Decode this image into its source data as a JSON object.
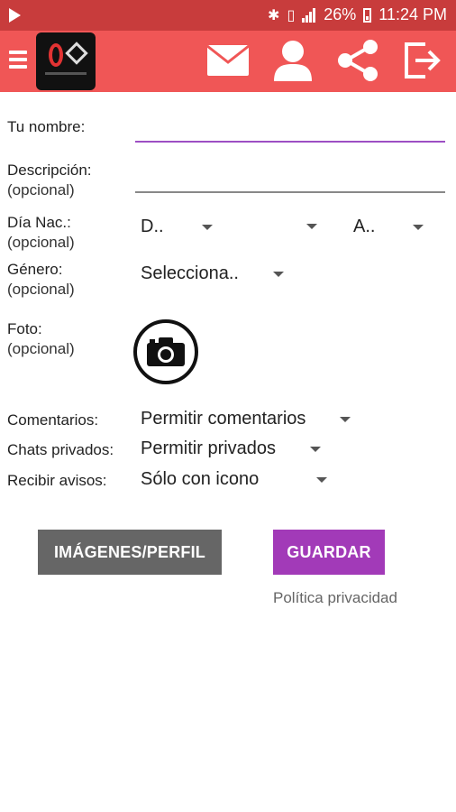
{
  "status_bar": {
    "battery": "26%",
    "time": "11:24 PM"
  },
  "app_bar": {
    "actions": [
      {
        "icon": "mail-icon"
      },
      {
        "icon": "profile-icon"
      },
      {
        "icon": "share-icon"
      },
      {
        "icon": "logout-icon"
      }
    ]
  },
  "form": {
    "name": {
      "label": "Tu nombre:",
      "value": ""
    },
    "description": {
      "label": "Descripción:",
      "optional": "(opcional)",
      "value": ""
    },
    "birth": {
      "label": "Día Nac.:",
      "optional": "(opcional)",
      "day": "D..",
      "year": "A.."
    },
    "gender": {
      "label": "Género:",
      "optional": "(opcional)",
      "value": "Selecciona.."
    },
    "photo": {
      "label": "Foto:",
      "optional": "(opcional)"
    },
    "comments": {
      "label": "Comentarios:",
      "value": "Permitir comentarios"
    },
    "private_chats": {
      "label": "Chats privados:",
      "value": "Permitir privados"
    },
    "notifications": {
      "label": "Recibir avisos:",
      "value": "Sólo con icono"
    }
  },
  "buttons": {
    "images_profile": "IMÁGENES/PERFIL",
    "save": "GUARDAR"
  },
  "privacy_link": "Política privacidad",
  "colors": {
    "status_bar": "#c83c3c",
    "app_bar": "#f05656",
    "accent": "#a23ab8",
    "gray_button": "#666666"
  }
}
